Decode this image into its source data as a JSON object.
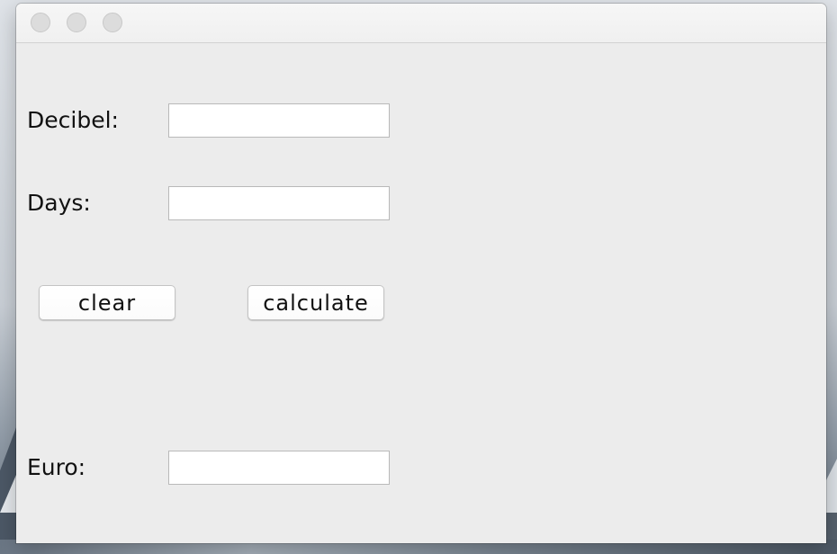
{
  "window": {
    "controls": [
      "close",
      "minimize",
      "zoom"
    ]
  },
  "form": {
    "decibel": {
      "label": "Decibel:",
      "value": "",
      "placeholder": ""
    },
    "days": {
      "label": "Days:",
      "value": "",
      "placeholder": ""
    },
    "euro": {
      "label": "Euro:",
      "value": "",
      "placeholder": ""
    }
  },
  "buttons": {
    "clear_label": "clear",
    "calculate_label": "calculate"
  }
}
